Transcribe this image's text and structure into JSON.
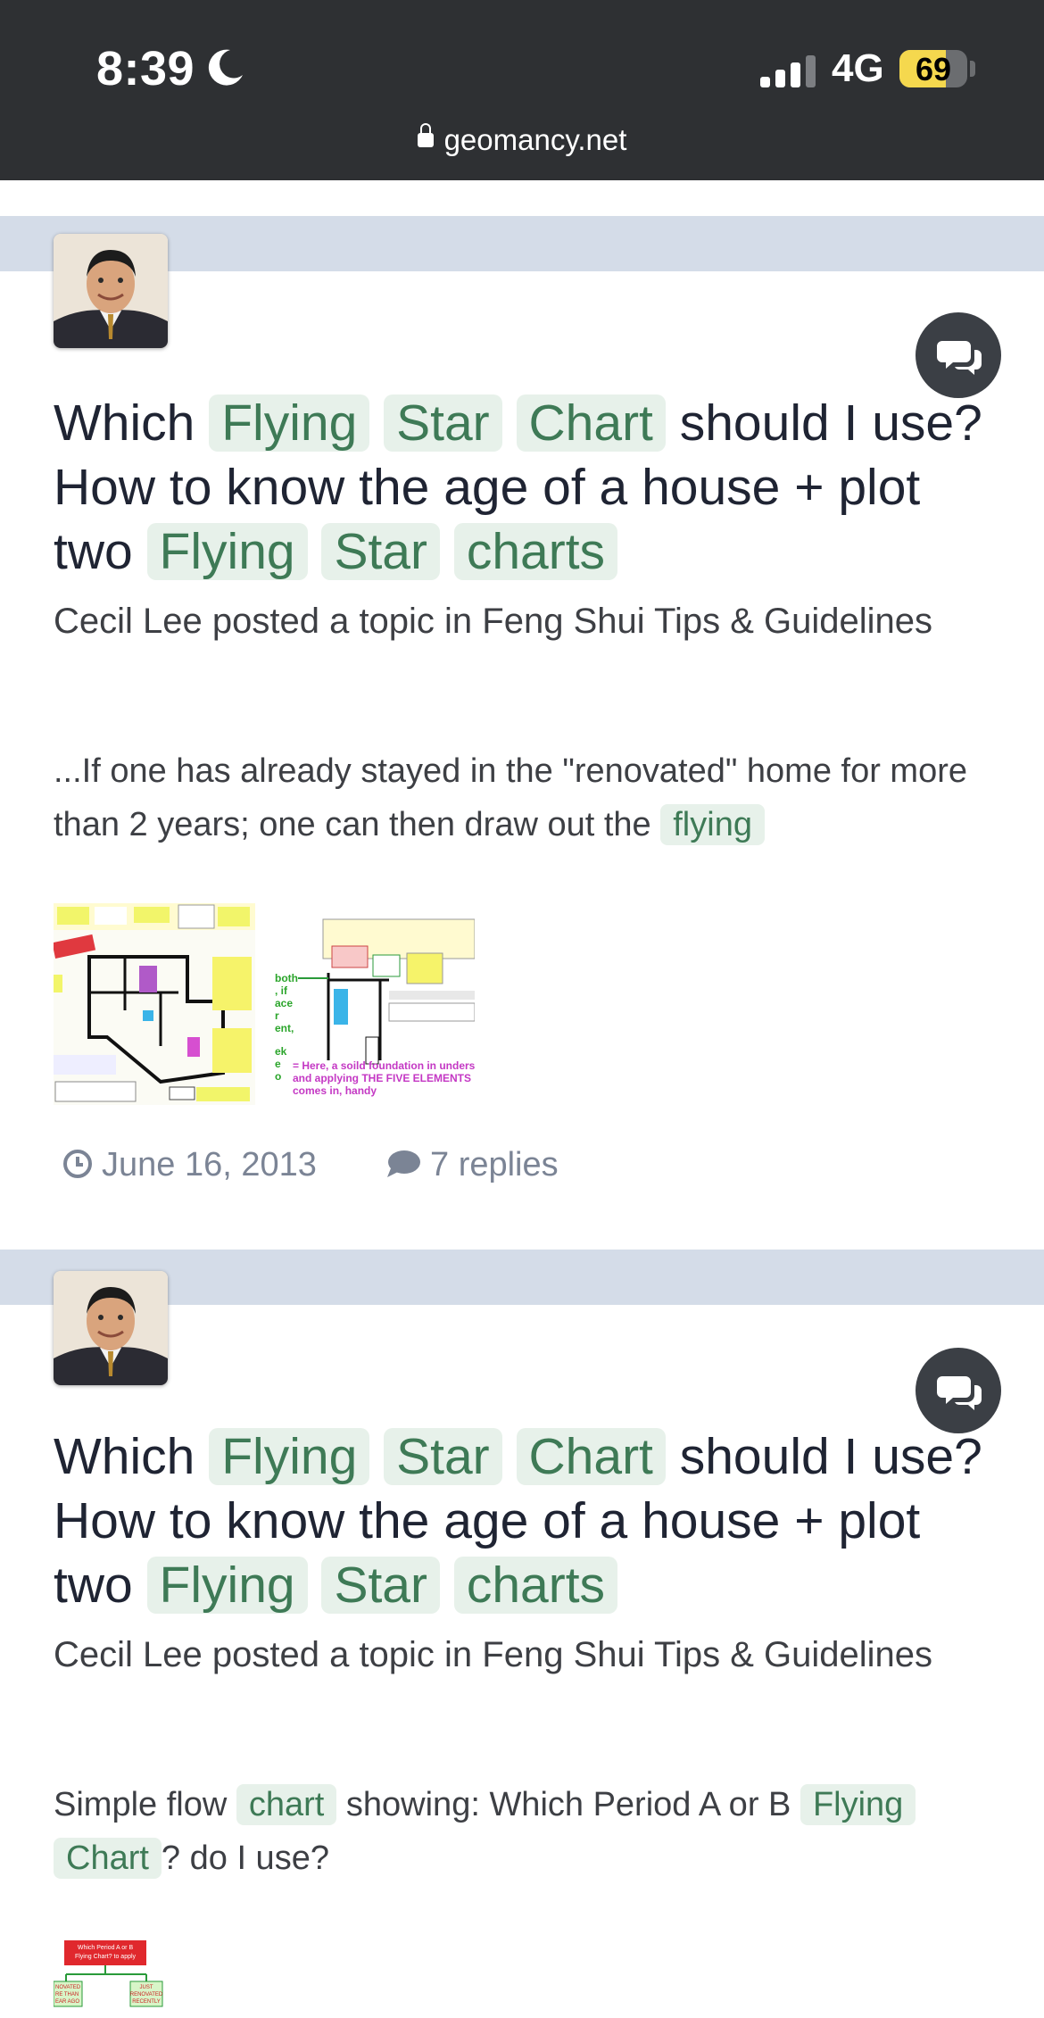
{
  "status_bar": {
    "time": "8:39",
    "network": "4G",
    "battery_level": "69",
    "battery_fraction": 0.69,
    "url": "geomancy.net"
  },
  "colors": {
    "status_bar_bg": "#2e3033",
    "band": "#d4dce8",
    "highlight_bg": "#e7f1ea",
    "highlight_text": "#3e7a56",
    "battery_fill": "#f5d84e",
    "fab": "#3b3f45"
  },
  "posts": [
    {
      "avatar_icon": "author-photo",
      "action_icon": "comments-icon",
      "title": {
        "w1": "Which",
        "h1": "Flying",
        "h2": "Star",
        "h3": "Chart",
        "w2": "should I use? How to know the age of a house + plot two",
        "h4": "Flying",
        "h5": "Star",
        "h6": "charts"
      },
      "meta": "Cecil Lee posted a topic in Feng Shui Tips & Guidelines",
      "snippet": {
        "t1": "...If one has already stayed in the \"renovated\" home for more than 2 years; one can then draw out the",
        "h1": "flying"
      },
      "thumb2_text": {
        "side": "both , if ace r ent, ek e o",
        "caption": "= Here, a soild foundation in unders and applying THE FIVE ELEMENTS comes in, handy"
      },
      "date": "June 16, 2013",
      "replies": "7 replies",
      "date_icon": "clock-icon",
      "replies_icon": "speech-bubble-icon"
    },
    {
      "avatar_icon": "author-photo",
      "action_icon": "comments-icon",
      "title": {
        "w1": "Which",
        "h1": "Flying",
        "h2": "Star",
        "h3": "Chart",
        "w2": "should I use? How to know the age of a house + plot two",
        "h4": "Flying",
        "h5": "Star",
        "h6": "charts"
      },
      "meta": "Cecil Lee posted a topic in Feng Shui Tips & Guidelines",
      "snippet": {
        "t1": "Simple flow",
        "h1": "chart",
        "t2": "showing: Which Period A or B",
        "h2": "Flying",
        "h3": "Chart",
        "t3": "? do I use?"
      },
      "thumb_text": {
        "header": "Which Period A or B Flying Chart? to apply",
        "left": "NOVATED RE THAN EAR AGO",
        "right": "JUST RENOVATED RECENTLY"
      }
    }
  ]
}
